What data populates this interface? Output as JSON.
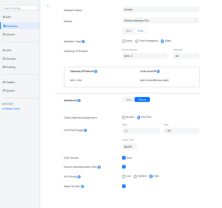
{
  "sidebar": {
    "search_placeholder": "Search Settings",
    "items": [
      {
        "label": "WiFi",
        "icon": "wifi-icon"
      },
      {
        "label": "Networks",
        "icon": "networks-icon",
        "active": true
      },
      {
        "label": "Internet",
        "icon": "globe-icon"
      },
      {
        "label": "VPN",
        "icon": "vpn-icon"
      },
      {
        "label": "Security",
        "icon": "shield-icon"
      },
      {
        "label": "Routing",
        "icon": "routing-icon"
      },
      {
        "label": "Profiles",
        "icon": "profiles-icon"
      },
      {
        "label": "System",
        "icon": "gear-icon"
      }
    ],
    "version": "ork 8.0.24",
    "release_notes": "y Release Notes"
  },
  "form": {
    "network_name_label": "Network Name",
    "network_name_value": "Docker",
    "router_label": "Router",
    "router_value": "Dream Machine Pro",
    "ip_tabs": [
      "IPv4",
      "IPv6"
    ],
    "ip_tab_active": "IPv6",
    "interface_type_label": "Interface Type",
    "interface_options": [
      "None",
      "Prefix Delegation",
      "Static"
    ],
    "interface_selected": "Static",
    "gateway_subnet_label": "Gateway IP/Subnet",
    "prefix_address_label": "Prefix Address",
    "prefix_address_value": "fd01::1",
    "netmask_label": "Netmask",
    "netmask_value": "64",
    "gw_box": {
      "gateway_header": "Gateway IP/Subnet",
      "gateway_value": "fd01::1/64",
      "link_local_header": "Link Local IP",
      "link_local_value": "fe80::f6e8:f8ff:feaa:3ad5"
    },
    "advanced_label": "Advanced",
    "advanced_options": [
      "Auto",
      "Manual"
    ],
    "advanced_selected": "Manual",
    "client_address_label": "Client Address Assignment",
    "client_options": [
      "SLAAC",
      "DHCPv6"
    ],
    "client_selected": "DHCPv6",
    "dhcp_range_label": "DHCPv6 Range",
    "start_label": "Start",
    "start_value": "::2",
    "stop_label": "Stop",
    "stop_value": "::7ff",
    "lease_time_label": "Lease Time",
    "lease_time_value": "86400",
    "dns_server_label": "DNS Server",
    "dns_server_option": "Auto",
    "router_adv_label": "Router Advertisement (RA)",
    "ra_priority_label": "RA Priority",
    "ra_priority_options": [
      "Low",
      "Medium",
      "High"
    ],
    "ra_priority_selected": "High",
    "allow_slaac_label": "Allow SLAAC"
  },
  "icons": {
    "back": "chevron-left-icon",
    "dropdown": "chevron-down-icon",
    "info": "info-icon",
    "check": "check-icon"
  },
  "colors": {
    "accent": "#006fff",
    "active_bg": "#e2ecfd",
    "sidebar_bg": "#f4f5f6"
  }
}
